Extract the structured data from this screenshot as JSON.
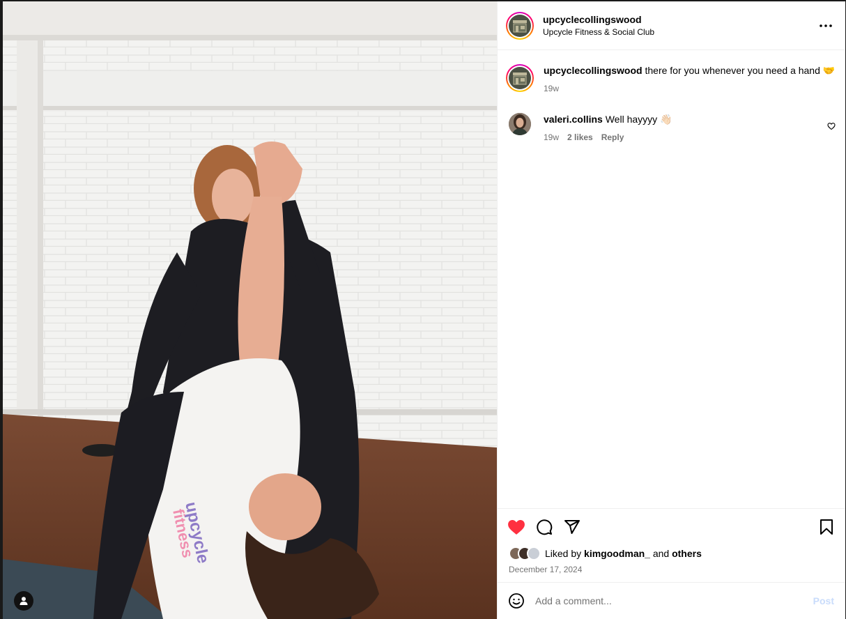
{
  "post": {
    "username": "upcyclecollingswood",
    "location": "Upcycle Fitness & Social Club",
    "more_icon": "more-horizontal-icon"
  },
  "caption": {
    "username": "upcyclecollingswood",
    "text": "there for you whenever you need a hand 🤝",
    "time": "19w"
  },
  "comments": [
    {
      "username": "valeri.collins",
      "text": "Well hayyyy 👋🏻",
      "time": "19w",
      "likes": "2 likes",
      "reply_label": "Reply"
    }
  ],
  "likes": {
    "prefix": "Liked by",
    "user": "kimgoodman_",
    "and": "and",
    "others": "others"
  },
  "date": "December 17, 2024",
  "comment_box": {
    "placeholder": "Add a comment...",
    "post_label": "Post"
  },
  "colors": {
    "like_red": "#ff3040",
    "post_disabled": "#c9dcfb",
    "secondary_text": "#737373"
  }
}
